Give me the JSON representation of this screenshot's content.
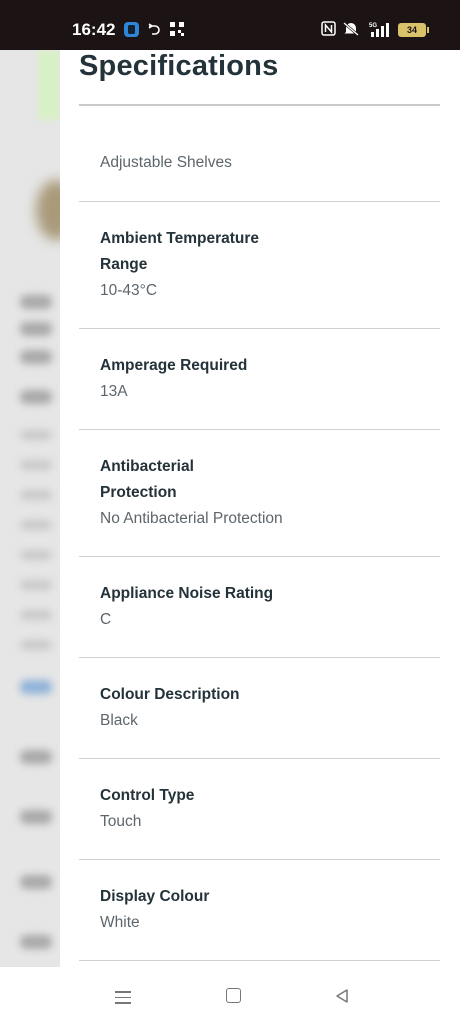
{
  "status_bar": {
    "time": "16:42",
    "icons": [
      "app-notification-icon",
      "sync-icon",
      "qr-icon",
      "nfc-icon",
      "mute-icon",
      "5g-signal-icon"
    ],
    "battery": "34"
  },
  "drawer": {
    "title": "Specifications",
    "specs": [
      {
        "name": "",
        "value": "Adjustable Shelves"
      },
      {
        "name": "Ambient Temperature Range",
        "value": "10-43°C"
      },
      {
        "name": "Amperage Required",
        "value": "13A"
      },
      {
        "name": "Antibacterial Protection",
        "value": "No Antibacterial Protection"
      },
      {
        "name": "Appliance Noise Rating",
        "value": "C"
      },
      {
        "name": "Colour Description",
        "value": "Black"
      },
      {
        "name": "Control Type",
        "value": "Touch"
      },
      {
        "name": "Display Colour",
        "value": "White"
      }
    ]
  },
  "nav_bar": {
    "icons": [
      "menu-icon",
      "home-icon",
      "back-icon"
    ]
  }
}
